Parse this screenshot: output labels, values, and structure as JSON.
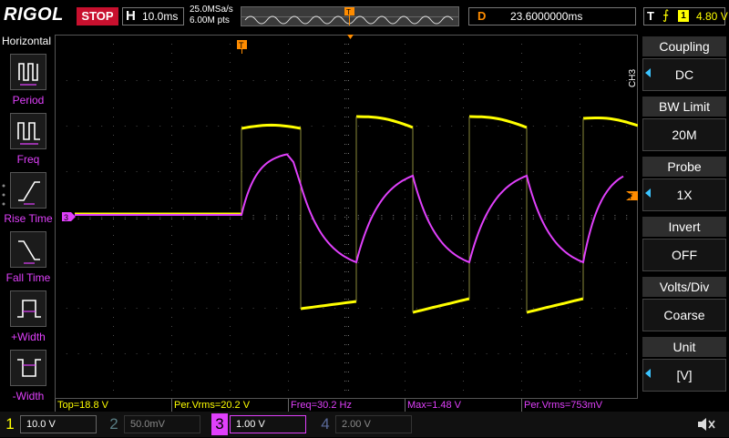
{
  "topbar": {
    "brand": "RIGOL",
    "run_state": "STOP",
    "timebase_letter": "H",
    "timebase": "10.0ms",
    "sample_rate": "25.0MSa/s",
    "points": "6.00M pts",
    "delay_letter": "D",
    "delay": "23.6000000ms",
    "trigger_letter": "T",
    "trigger_slope": "⨍",
    "trigger_source": "1",
    "trigger_level": "4.80 V"
  },
  "left_panel": {
    "title": "Horizontal",
    "items": [
      {
        "label": "Period"
      },
      {
        "label": "Freq"
      },
      {
        "label": "Rise Time"
      },
      {
        "label": "Fall Time"
      },
      {
        "label": "+Width"
      },
      {
        "label": "-Width"
      }
    ]
  },
  "right_menu": {
    "channel_tag": "CH3",
    "items": [
      {
        "title": "Coupling",
        "value": "DC"
      },
      {
        "title": "BW Limit",
        "value": "20M"
      },
      {
        "title": "Probe",
        "value": "1X"
      },
      {
        "title": "Invert",
        "value": "OFF"
      },
      {
        "title": "Volts/Div",
        "value": "Coarse"
      },
      {
        "title": "Unit",
        "value": "[V]"
      }
    ]
  },
  "measurements": [
    {
      "text": "Top=18.8 V",
      "color": "#ffff00"
    },
    {
      "text": "Per.Vrms=20.2 V",
      "color": "#ffff00"
    },
    {
      "text": "Freq=30.2 Hz",
      "color": "#e040fb"
    },
    {
      "text": "Max=1.48 V",
      "color": "#e040fb"
    },
    {
      "text": "Per.Vrms=753mV",
      "color": "#e040fb"
    }
  ],
  "channels": [
    {
      "num": "1",
      "scale": "10.0 V",
      "color": "#ffff00",
      "active": true
    },
    {
      "num": "2",
      "scale": "50.0mV",
      "color": "#4fc3f7",
      "active": false
    },
    {
      "num": "3",
      "scale": "1.00 V",
      "color": "#e040fb",
      "active": true
    },
    {
      "num": "4",
      "scale": "2.00 V",
      "color": "#4169e1",
      "active": false
    }
  ],
  "markers": {
    "trigger_pos": "T",
    "ch3_marker": "3",
    "trig_level_marker": "T"
  },
  "colors": {
    "ch1": "#ffff00",
    "ch3": "#e040fb",
    "menu_accent": "#3ac3ff",
    "stop": "#c8102e",
    "delay": "#ff8c00"
  }
}
